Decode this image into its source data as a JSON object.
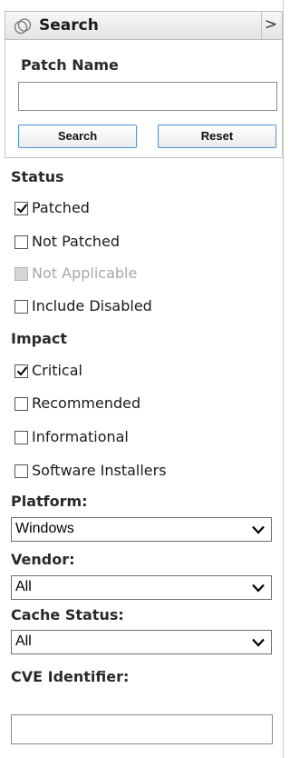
{
  "header": {
    "title": "Search",
    "collapse_icon": "chevron-right-icon",
    "logo_icon": "search-circles-icon"
  },
  "patch_search": {
    "label": "Patch Name",
    "value": "",
    "search_button": "Search",
    "reset_button": "Reset",
    "button_border_color": "#4a90e2"
  },
  "status": {
    "title": "Status",
    "items": [
      {
        "label": "Patched",
        "checked": true,
        "disabled": false
      },
      {
        "label": "Not Patched",
        "checked": false,
        "disabled": false
      },
      {
        "label": "Not Applicable",
        "checked": false,
        "disabled": true
      },
      {
        "label": "Include Disabled",
        "checked": false,
        "disabled": false
      }
    ]
  },
  "impact": {
    "title": "Impact",
    "items": [
      {
        "label": "Critical",
        "checked": true,
        "disabled": false
      },
      {
        "label": "Recommended",
        "checked": false,
        "disabled": false
      },
      {
        "label": "Informational",
        "checked": false,
        "disabled": false
      },
      {
        "label": "Software Installers",
        "checked": false,
        "disabled": false
      }
    ]
  },
  "platform": {
    "label": "Platform:",
    "value": "Windows"
  },
  "vendor": {
    "label": "Vendor:",
    "value": "All"
  },
  "cache_status": {
    "label": "Cache Status:",
    "value": "All"
  },
  "cve": {
    "label": "CVE Identifier:",
    "value": ""
  }
}
